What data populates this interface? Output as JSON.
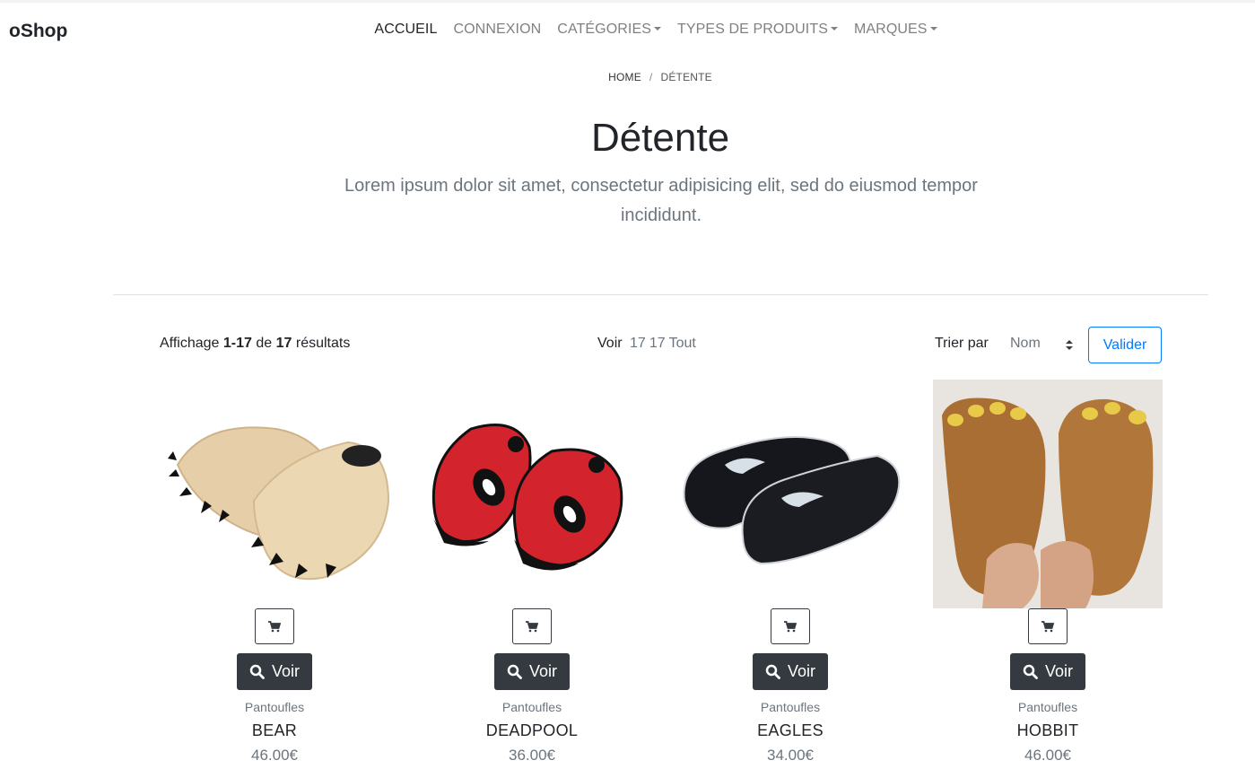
{
  "brand": "oShop",
  "nav": {
    "accueil": "ACCUEIL",
    "connexion": "CONNEXION",
    "categories": "CATÉGORIES",
    "types": "TYPES DE PRODUITS",
    "marques": "MARQUES"
  },
  "breadcrumb": {
    "home": "HOME",
    "separator": "/",
    "current": "DÉTENTE"
  },
  "page": {
    "title": "Détente",
    "lead": "Lorem ipsum dolor sit amet, consectetur adipisicing elit, sed do eiusmod tempor incididunt."
  },
  "toolbar": {
    "results_prefix": "Affichage",
    "results_range": "1-17",
    "results_of": "de",
    "results_total": "17",
    "results_suffix": "résultats",
    "voir_label": "Voir",
    "per_page_options": [
      "17",
      "17",
      "Tout"
    ],
    "sort_label": "Trier par",
    "sort_value": "Nom",
    "submit_label": "Valider"
  },
  "products": [
    {
      "type": "Pantoufles",
      "name": "BEAR",
      "price": "46.00€",
      "button": "Voir"
    },
    {
      "type": "Pantoufles",
      "name": "DEADPOOL",
      "price": "36.00€",
      "button": "Voir"
    },
    {
      "type": "Pantoufles",
      "name": "EAGLES",
      "price": "34.00€",
      "button": "Voir"
    },
    {
      "type": "Pantoufles",
      "name": "HOBBIT",
      "price": "46.00€",
      "button": "Voir"
    }
  ],
  "colors": {
    "dark_button": "#343a40",
    "primary": "#007bff",
    "muted": "#6c757d"
  }
}
